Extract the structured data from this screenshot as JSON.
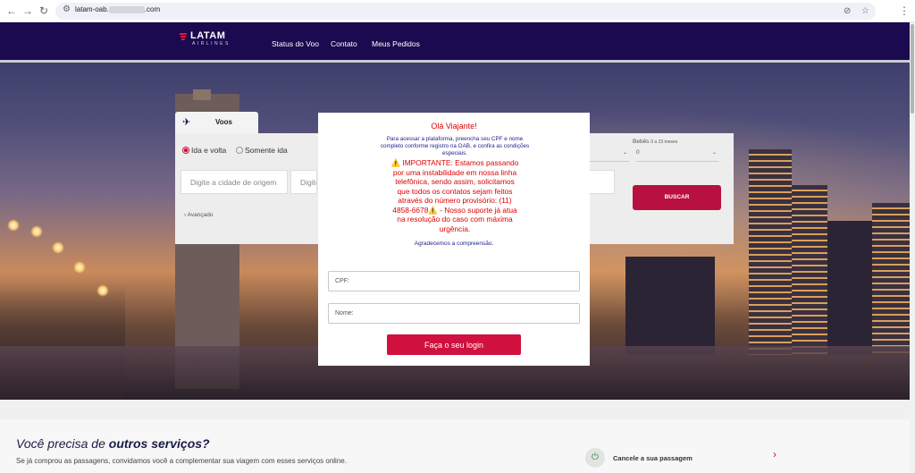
{
  "browser": {
    "url_prefix": "latam-oab.",
    "url_suffix": ".com",
    "icons": [
      "back-arrow-icon",
      "forward-arrow-icon",
      "reload-icon",
      "site-settings-icon",
      "eye-off-icon",
      "star-icon",
      "kebab-menu-icon"
    ]
  },
  "header": {
    "logo_top": "LATAM",
    "logo_bottom": "AIRLINES",
    "menu": [
      "Status do Voo",
      "Contato",
      "Meus Pedidos"
    ]
  },
  "booking": {
    "tab": "Voos",
    "trip_round": "Ida e volta",
    "trip_oneway": "Somente ida",
    "origin_placeholder": "Digite a cidade de origem",
    "destination_placeholder": "Digite a",
    "advanced": "Avançado",
    "babies_label": "Bebês",
    "babies_hint": "0 a 23 meses",
    "babies_value": "0",
    "search_button": "BUSCAR"
  },
  "modal": {
    "greeting": "Olá Viajante!",
    "instructions": "Para acessar a plataforma, preencha seu CPF e nome completo conforme registro na OAB, e confira as condições especiais.",
    "important": "⚠️ IMPORTANTE: Estamos passando por uma instabilidade em nossa linha telefônica, sendo assim, solicitamos que todos os contatos sejam feitos através do número provisório: (11) 4858-6678⚠️ - Nosso suporte já atua na resolução do caso com máxima urgência.",
    "thanks": "Agradecemos a compreensão.",
    "cpf_placeholder": "CPF:",
    "name_placeholder": "Nome:",
    "login_button": "Faça o seu login"
  },
  "services": {
    "title_plain": "Você precisa de ",
    "title_bold": "outros serviços?",
    "subtitle": "Se já comprou as passagens, convidamos você a complementar sua viagem com esses serviços online.",
    "cancel_label": "Cancele a sua passagem"
  },
  "colors": {
    "header_bg": "#1b0a50",
    "brand_red": "#d0103f",
    "modal_red": "#e00000",
    "modal_blue": "#1d1d8a"
  }
}
